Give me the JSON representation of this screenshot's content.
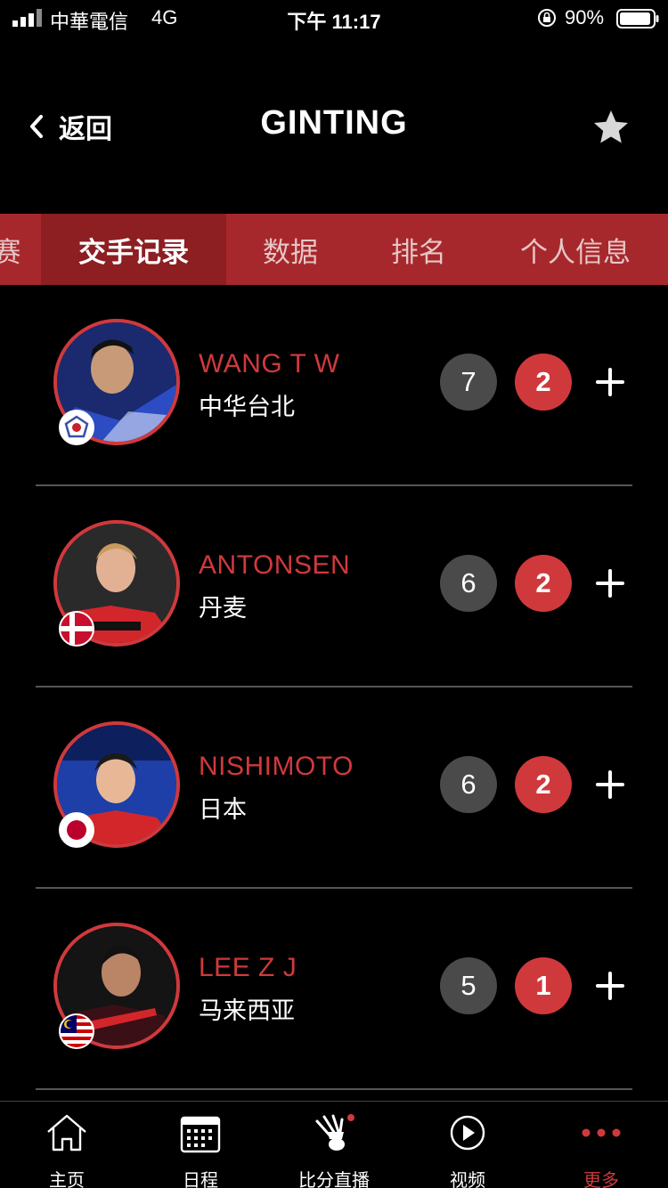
{
  "status_bar": {
    "carrier": "中華電信",
    "network": "4G",
    "time": "下午 11:17",
    "battery": "90%"
  },
  "header": {
    "back_label": "返回",
    "title": "GINTING",
    "star_icon": "star-icon"
  },
  "tabs": [
    {
      "label": "赛"
    },
    {
      "label": "交手记录"
    },
    {
      "label": "数据"
    },
    {
      "label": "排名"
    },
    {
      "label": "个人信息"
    }
  ],
  "opponents": [
    {
      "name": "WANG T W",
      "country": "中华台北",
      "wins": "7",
      "losses": "2",
      "flag_icon": "chinese-taipei-flag-icon"
    },
    {
      "name": "ANTONSEN",
      "country": "丹麦",
      "wins": "6",
      "losses": "2",
      "flag_icon": "denmark-flag-icon"
    },
    {
      "name": "NISHIMOTO",
      "country": "日本",
      "wins": "6",
      "losses": "2",
      "flag_icon": "japan-flag-icon"
    },
    {
      "name": "LEE Z J",
      "country": "马来西亚",
      "wins": "5",
      "losses": "1",
      "flag_icon": "malaysia-flag-icon"
    }
  ],
  "bottom_nav": [
    {
      "label": "主页",
      "icon": "home-icon"
    },
    {
      "label": "日程",
      "icon": "calendar-icon"
    },
    {
      "label": "比分直播",
      "icon": "shuttlecock-icon"
    },
    {
      "label": "视频",
      "icon": "play-icon"
    },
    {
      "label": "更多",
      "icon": "more-icon"
    }
  ],
  "colors": {
    "accent": "#d0393c",
    "tab_bar": "#a7282c",
    "tab_active": "#8d1e22",
    "win_badge": "#4a4a4a"
  }
}
